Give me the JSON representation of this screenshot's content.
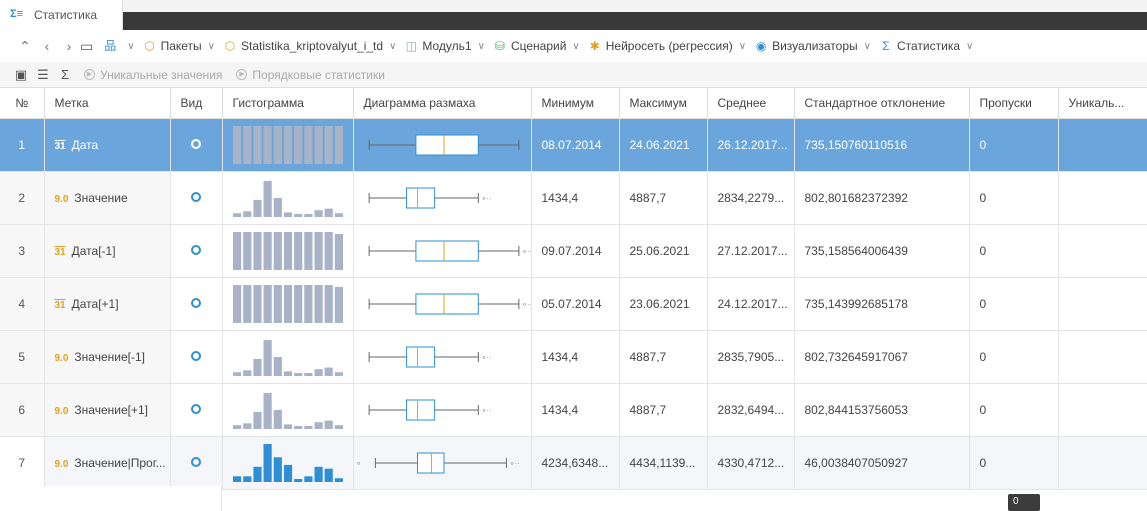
{
  "tab": {
    "icon": "statistics-icon",
    "label": "Статистика"
  },
  "crumbs": {
    "items": [
      {
        "label": "",
        "icon": "hierarchy-icon"
      },
      {
        "label": "Пакеты",
        "icon": "package-icon"
      },
      {
        "label": "Statistika_kriptovalyut_i_td",
        "icon": "package-icon"
      },
      {
        "label": "Модуль1",
        "icon": "module-icon"
      },
      {
        "label": "Сценарий",
        "icon": "scenario-icon"
      },
      {
        "label": "Нейросеть (регрессия)",
        "icon": "neural-icon"
      },
      {
        "label": "Визуализаторы",
        "icon": "eye-icon"
      },
      {
        "label": "Статистика",
        "icon": "statistics-icon"
      }
    ]
  },
  "subbar": {
    "unique_label": "Уникальные значения",
    "ordinal_label": "Порядковые статистики"
  },
  "columns": {
    "num": "№",
    "label": "Метка",
    "vid": "Вид",
    "hist": "Гистограмма",
    "box": "Диаграмма размаха",
    "min": "Минимум",
    "max": "Максимум",
    "mean": "Среднее",
    "std": "Стандартное отклонение",
    "miss": "Пропуски",
    "uniq": "Уникаль..."
  },
  "rows": [
    {
      "num": "1",
      "type": "31",
      "kind": "date",
      "label": "Дата",
      "min": "08.07.2014",
      "max": "24.06.2021",
      "mean": "26.12.2017...",
      "std": "735,150760110516",
      "miss": "0",
      "uniq": "",
      "hist": [
        1,
        1,
        1,
        1,
        1,
        1,
        1,
        1,
        1,
        1,
        1
      ],
      "box": {
        "lw": 0.02,
        "q1": 0.32,
        "med": 0.5,
        "q3": 0.72,
        "uw": 0.98,
        "out": false,
        "lout": false
      }
    },
    {
      "num": "2",
      "type": "9.0",
      "kind": "num",
      "label": "Значение",
      "min": "1434,4",
      "max": "4887,7",
      "mean": "2834,2279...",
      "std": "802,801682372392",
      "miss": "0",
      "uniq": "",
      "hist": [
        0.1,
        0.15,
        0.45,
        0.95,
        0.5,
        0.12,
        0.05,
        0.08,
        0.18,
        0.22,
        0.1
      ],
      "box": {
        "lw": 0.02,
        "q1": 0.26,
        "med": 0.33,
        "q3": 0.44,
        "uw": 0.72,
        "out": true,
        "lout": false
      }
    },
    {
      "num": "3",
      "type": "31",
      "kind": "date",
      "label": "Дата[-1]",
      "min": "09.07.2014",
      "max": "25.06.2021",
      "mean": "27.12.2017...",
      "std": "735,158564006439",
      "miss": "0",
      "uniq": "",
      "hist": [
        1,
        1,
        1,
        1,
        1,
        1,
        1,
        1,
        1,
        1,
        0.95
      ],
      "box": {
        "lw": 0.02,
        "q1": 0.32,
        "med": 0.5,
        "q3": 0.72,
        "uw": 0.98,
        "out": true,
        "lout": false
      }
    },
    {
      "num": "4",
      "type": "31",
      "kind": "date",
      "label": "Дата[+1]",
      "min": "05.07.2014",
      "max": "23.06.2021",
      "mean": "24.12.2017...",
      "std": "735,143992685178",
      "miss": "0",
      "uniq": "",
      "hist": [
        1,
        1,
        1,
        1,
        1,
        1,
        1,
        1,
        1,
        1,
        0.95
      ],
      "box": {
        "lw": 0.02,
        "q1": 0.32,
        "med": 0.5,
        "q3": 0.72,
        "uw": 0.98,
        "out": true,
        "lout": false
      }
    },
    {
      "num": "5",
      "type": "9.0",
      "kind": "num",
      "label": "Значение[-1]",
      "min": "1434,4",
      "max": "4887,7",
      "mean": "2835,7905...",
      "std": "802,732645917067",
      "miss": "0",
      "uniq": "",
      "hist": [
        0.1,
        0.15,
        0.45,
        0.95,
        0.5,
        0.12,
        0.05,
        0.08,
        0.18,
        0.22,
        0.1
      ],
      "box": {
        "lw": 0.02,
        "q1": 0.26,
        "med": 0.33,
        "q3": 0.44,
        "uw": 0.72,
        "out": true,
        "lout": false
      }
    },
    {
      "num": "6",
      "type": "9.0",
      "kind": "num",
      "label": "Значение[+1]",
      "min": "1434,4",
      "max": "4887,7",
      "mean": "2832,6494...",
      "std": "802,844153756053",
      "miss": "0",
      "uniq": "",
      "hist": [
        0.1,
        0.15,
        0.45,
        0.95,
        0.5,
        0.12,
        0.05,
        0.08,
        0.18,
        0.22,
        0.1
      ],
      "box": {
        "lw": 0.02,
        "q1": 0.26,
        "med": 0.33,
        "q3": 0.44,
        "uw": 0.72,
        "out": true,
        "lout": false
      }
    },
    {
      "num": "7",
      "type": "9.0",
      "kind": "num",
      "label": "Значение|Прог...",
      "min": "4234,6348...",
      "max": "4434,1139...",
      "mean": "4330,4712...",
      "std": "46,0038407050927",
      "miss": "0",
      "uniq": "",
      "hist": [
        0.15,
        0.15,
        0.4,
        1,
        0.65,
        0.45,
        0.05,
        0.15,
        0.4,
        0.35,
        0.1
      ],
      "box": {
        "lw": 0.06,
        "q1": 0.33,
        "med": 0.42,
        "q3": 0.5,
        "uw": 0.9,
        "out": true,
        "lout": true
      }
    }
  ],
  "tooltip": "0",
  "colors": {
    "accent": "#6aa6dc",
    "bar": "#a8b3c8",
    "bar_blue": "#2e8fd6",
    "box": "#2e8fd6",
    "median": "#e0a21e"
  }
}
